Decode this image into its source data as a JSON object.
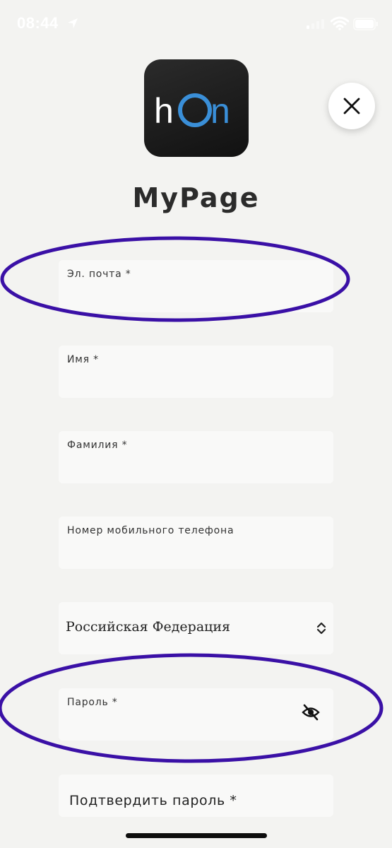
{
  "status_bar": {
    "time": "08:44",
    "icons": [
      "location-arrow-icon",
      "signal-icon",
      "wifi-icon",
      "battery-icon"
    ]
  },
  "app": {
    "logo_text_h": "h",
    "logo_text_o": "O",
    "logo_text_n": "n",
    "title": "MyPage",
    "brand_blue": "#3a8fd8"
  },
  "form": {
    "email_label": "Эл. почта *",
    "first_name_label": "Имя *",
    "last_name_label": "Фамилия *",
    "phone_label": "Номер мобильного телефона",
    "country_value": "Российская Федерация",
    "password_label": "Пароль *",
    "confirm_password_label": "Подтвердить пароль *"
  },
  "annotations": {
    "color": "#3a10a6",
    "highlighted": [
      "email-field",
      "password-field"
    ]
  }
}
